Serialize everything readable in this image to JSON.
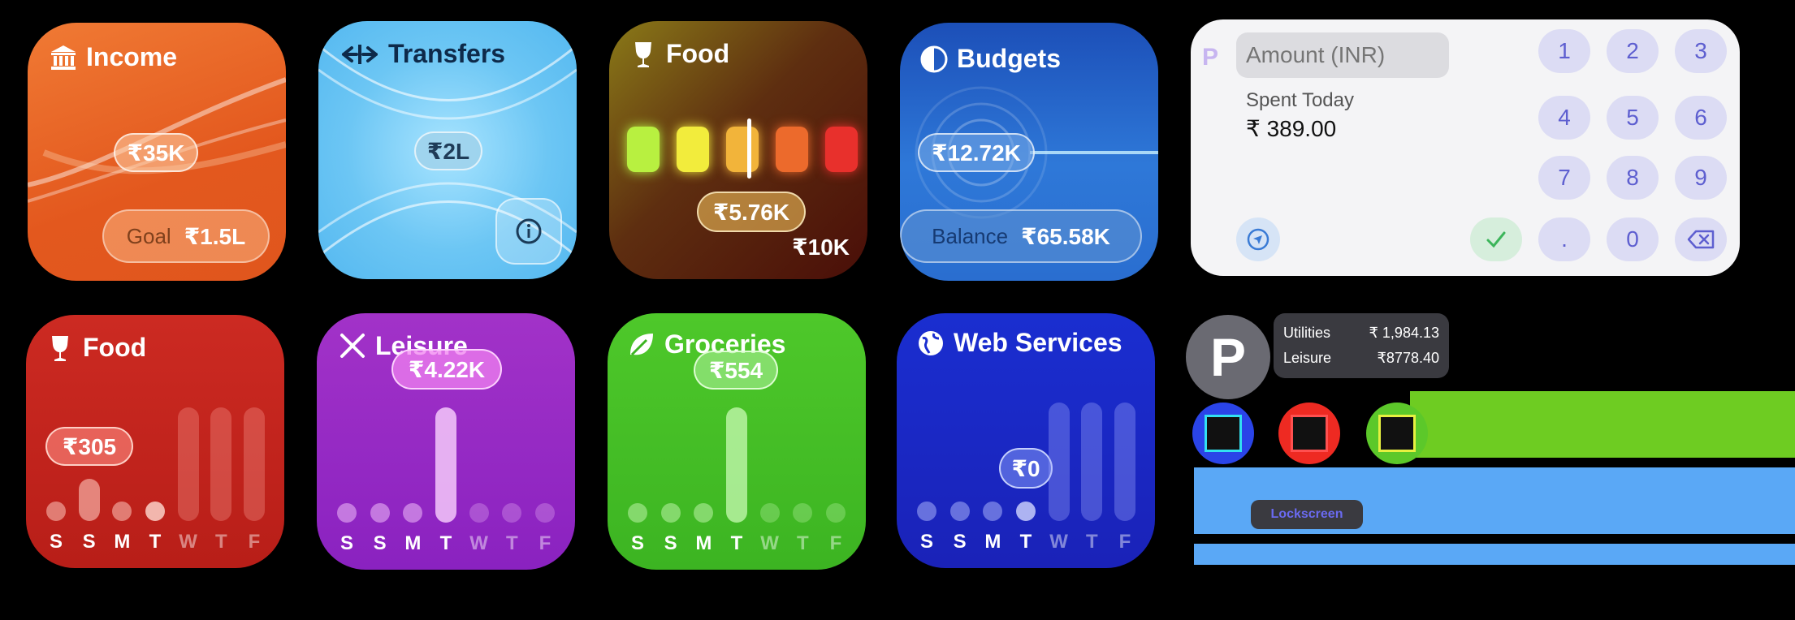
{
  "income": {
    "title": "Income",
    "amount": "₹35K",
    "goal_label": "Goal",
    "goal_value": "₹1.5L"
  },
  "transfers": {
    "title": "Transfers",
    "amount": "₹2L"
  },
  "food_top": {
    "title": "Food",
    "spent": "₹5.76K",
    "limit": "₹10K",
    "swatches": [
      "#b8f040",
      "#f2ec3c",
      "#f2b43a",
      "#ec6a2c",
      "#e8302c"
    ]
  },
  "budgets": {
    "title": "Budgets",
    "amount": "₹12.72K",
    "balance_label": "Balance",
    "balance_value": "₹65.58K"
  },
  "entry": {
    "amount_placeholder": "Amount (INR)",
    "spent_label": "Spent Today",
    "spent_value": "₹ 389.00",
    "keys": [
      "1",
      "2",
      "3",
      "4",
      "5",
      "6",
      "7",
      "8",
      "9",
      ".",
      "0"
    ]
  },
  "food_week": {
    "title": "Food",
    "amount": "₹305"
  },
  "leisure": {
    "title": "Leisure",
    "amount": "₹4.22K"
  },
  "groceries": {
    "title": "Groceries",
    "amount": "₹554"
  },
  "web": {
    "title": "Web Services",
    "amount": "₹0"
  },
  "days": [
    "S",
    "S",
    "M",
    "T",
    "W",
    "T",
    "F"
  ],
  "lockscreen": {
    "rows": [
      {
        "label": "Utilities",
        "value": "₹ 1,984.13"
      },
      {
        "label": "Leisure",
        "value": "₹8778.40"
      }
    ],
    "tag": "Lockscreen"
  }
}
